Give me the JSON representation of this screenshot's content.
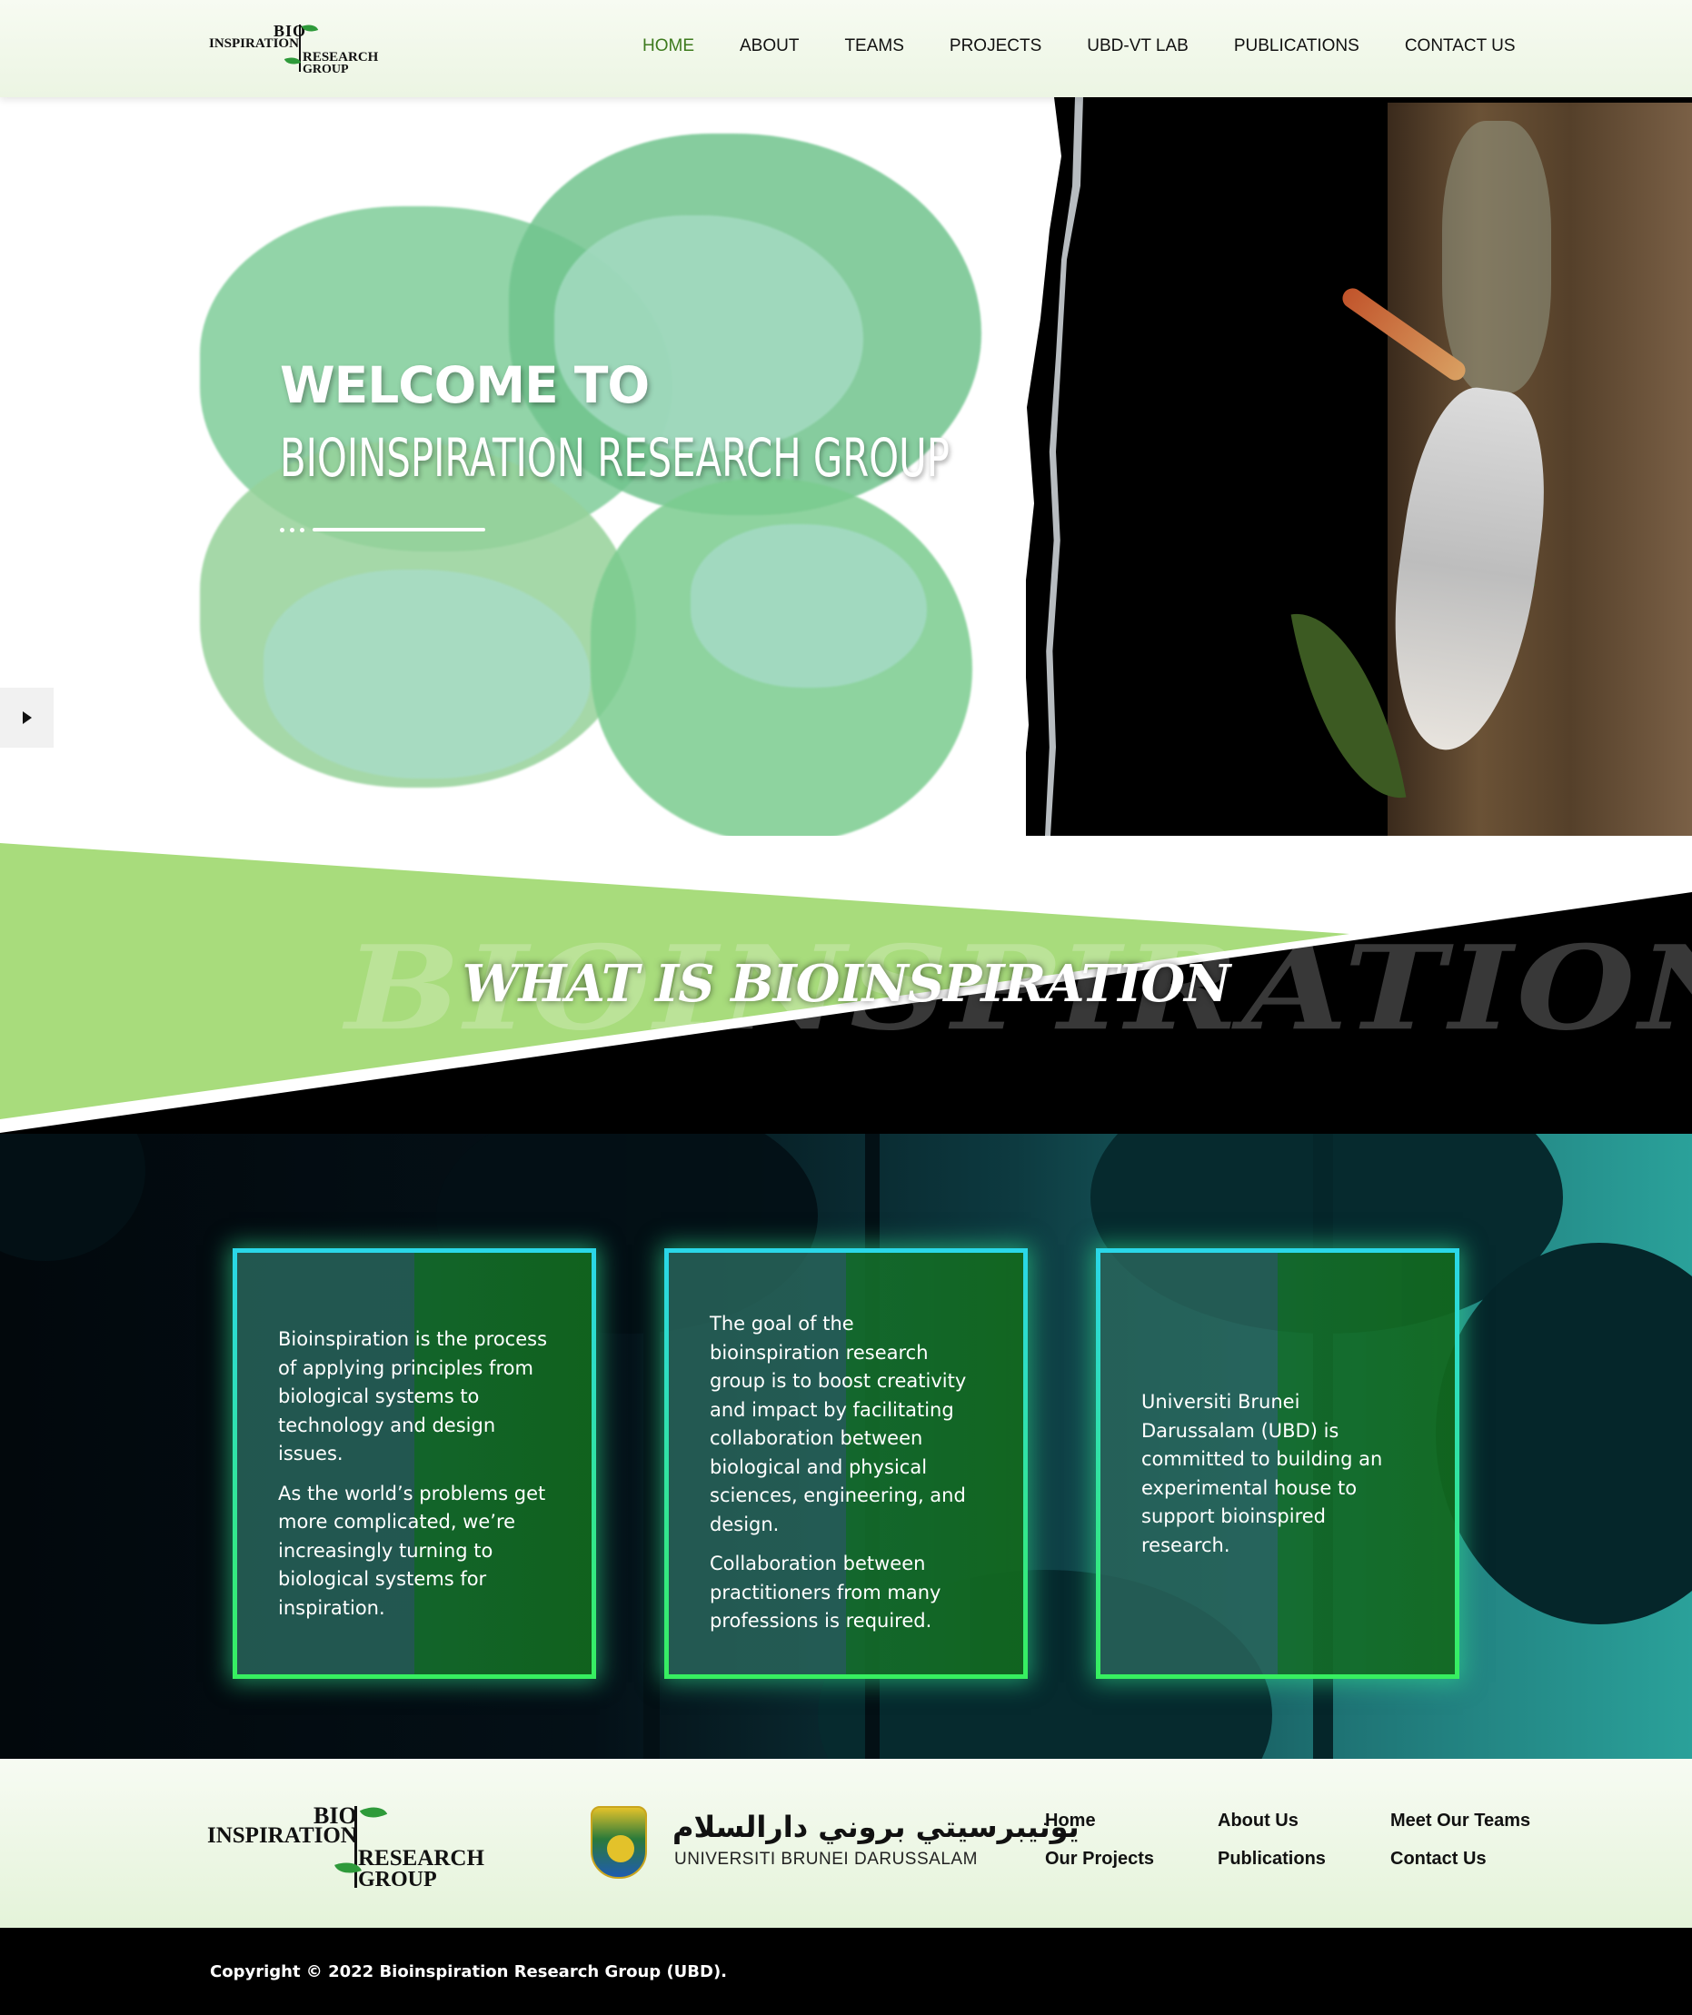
{
  "nav": {
    "logo": {
      "bio": "BIO",
      "inspiration": "INSPIRATION",
      "research": "RESEARCH",
      "group": "GROUP"
    },
    "items": [
      {
        "label": "HOME",
        "active": true
      },
      {
        "label": "ABOUT",
        "active": false
      },
      {
        "label": "TEAMS",
        "active": false
      },
      {
        "label": "PROJECTS",
        "active": false
      },
      {
        "label": "UBD-VT LAB",
        "active": false
      },
      {
        "label": "PUBLICATIONS",
        "active": false
      },
      {
        "label": "CONTACT US",
        "active": false
      }
    ],
    "active_color": "#3d7a1d"
  },
  "hero": {
    "welcome": "WELCOME TO",
    "title": "BIOINSPIRATION RESEARCH GROUP",
    "play_icon": "play-icon"
  },
  "band": {
    "background_word": "BIOINSPIRATION",
    "title": "WHAT IS BIOINSPIRATION",
    "green": "#a8dc7c"
  },
  "cards": [
    {
      "paragraphs": [
        "Bioinspiration is the process of applying principles from biological systems to technology and design issues.",
        "As the world’s problems get more complicated, we’re increasingly turning to biological systems for inspiration."
      ]
    },
    {
      "paragraphs": [
        "The goal of the bioinspiration research group is to boost creativity and impact by facilitating collaboration between biological and physical sciences, engineering, and design.",
        "Collaboration between practitioners from many professions is required."
      ]
    },
    {
      "paragraphs": [
        "Universiti Brunei Darussalam (UBD) is committed to building an experimental house to support bioinspired research."
      ]
    }
  ],
  "footer": {
    "logo": {
      "bio": "BIO",
      "inspiration": "INSPIRATION",
      "research": "RESEARCH",
      "group": "GROUP"
    },
    "ubd": {
      "arabic": "يونيبرسيتي بروني دارالسلام",
      "english": "UNIVERSITI BRUNEI DARUSSALAM"
    },
    "links": [
      "Home",
      "About Us",
      "Meet Our Teams",
      "Our Projects",
      "Publications",
      "Contact Us"
    ],
    "copyright": "Copyright © 2022 Bioinspiration Research Group (UBD)."
  }
}
